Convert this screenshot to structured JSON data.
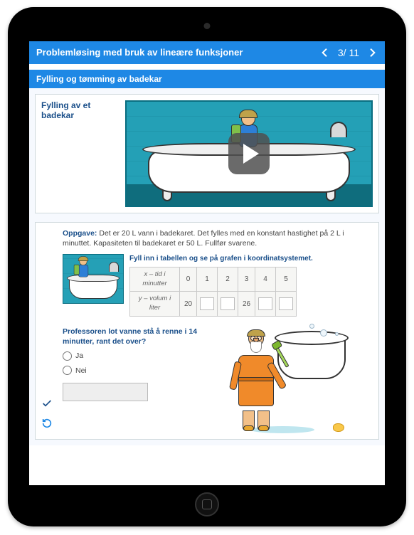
{
  "header": {
    "title": "Problemløsing med bruk av lineære funksjoner",
    "page_current": "3",
    "page_sep": "/",
    "page_total": "11"
  },
  "subheader": "Fylling og tømming av badekar",
  "video": {
    "caption": "Fylling av et badekar"
  },
  "task": {
    "label": "Oppgave:",
    "text": "Det er 20 L vann i badekaret. Det fylles med en konstant hastighet på 2 L i minuttet. Kapasiteten til badekaret er 50 L. Fullfør svarene.",
    "fill_instruction": "Fyll inn i tabellen og se på grafen i koordinatsystemet.",
    "row_x_label": "x – tid i minutter",
    "row_y_label": "y – volum i liter",
    "x_values": [
      "0",
      "1",
      "2",
      "3",
      "4",
      "5"
    ],
    "y_known_0": "20",
    "y_known_3": "26"
  },
  "question": {
    "text": "Professoren lot vanne stå å renne i 14 minutter, rant det over?",
    "opt_yes": "Ja",
    "opt_no": "Nei"
  }
}
